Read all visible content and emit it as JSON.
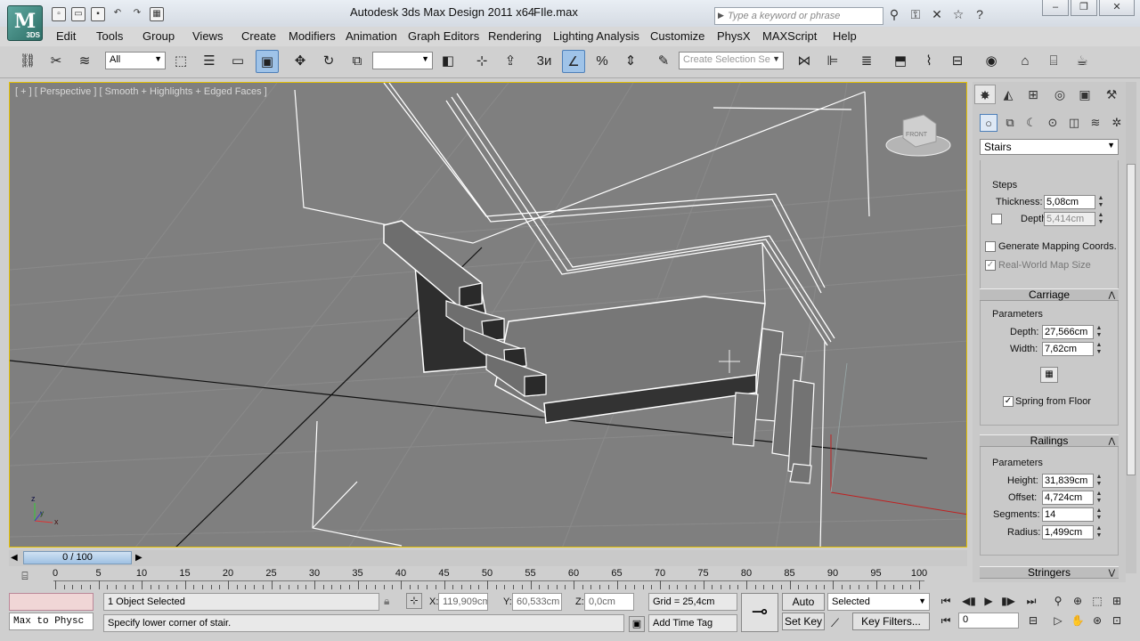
{
  "title": {
    "app": "Autodesk 3ds Max Design 2011 x64",
    "file": "FIle.max",
    "search_placeholder": "Type a keyword or phrase",
    "logo_text": "3DS"
  },
  "menu": [
    "Edit",
    "Tools",
    "Group",
    "Views",
    "Create",
    "Modifiers",
    "Animation",
    "Graph Editors",
    "Rendering",
    "Lighting Analysis",
    "Customize",
    "PhysX",
    "MAXScript",
    "Help"
  ],
  "toolbar": {
    "filter": "All",
    "selection_set": "Create Selection Se"
  },
  "viewport": {
    "label": "[ + ] [ Perspective ] [ Smooth + Highlights + Edged Faces ]",
    "viewcube_face": "FRONT",
    "axis_x": "x",
    "axis_y": "y",
    "axis_z": "z"
  },
  "command_panel": {
    "object_type": "Stairs",
    "steps": {
      "title": "Steps",
      "thickness_label": "Thickness:",
      "thickness": "5,08cm",
      "depth_label": "Depth:",
      "depth": "5,414cm"
    },
    "generate_mapping": "Generate Mapping Coords.",
    "real_world": "Real-World Map Size",
    "carriage": {
      "title": "Carriage",
      "params": "Parameters",
      "depth_label": "Depth:",
      "depth": "27,566cm",
      "width_label": "Width:",
      "width": "7,62cm",
      "spring": "Spring from Floor"
    },
    "railings": {
      "title": "Railings",
      "params": "Parameters",
      "height_label": "Height:",
      "height": "31,839cm",
      "offset_label": "Offset:",
      "offset": "4,724cm",
      "segments_label": "Segments:",
      "segments": "14",
      "radius_label": "Radius:",
      "radius": "1,499cm"
    },
    "stringers": "Stringers"
  },
  "timeline": {
    "slider": "0 / 100",
    "ticks": [
      "0",
      "5",
      "10",
      "15",
      "20",
      "25",
      "30",
      "35",
      "40",
      "45",
      "50",
      "55",
      "60",
      "65",
      "70",
      "75",
      "80",
      "85",
      "90",
      "95",
      "100"
    ]
  },
  "status": {
    "script_listener": "Max to Physc",
    "selection": "1 Object Selected",
    "prompt": "Specify lower corner of stair.",
    "x_label": "X:",
    "x": "119,909cm",
    "y_label": "Y:",
    "y": "60,533cm",
    "z_label": "Z:",
    "z": "0,0cm",
    "grid": "Grid = 25,4cm",
    "add_time_tag": "Add Time Tag",
    "auto_key": "Auto Key",
    "set_key": "Set Key",
    "key_mode": "Selected",
    "key_filters": "Key Filters...",
    "frame": "0"
  }
}
